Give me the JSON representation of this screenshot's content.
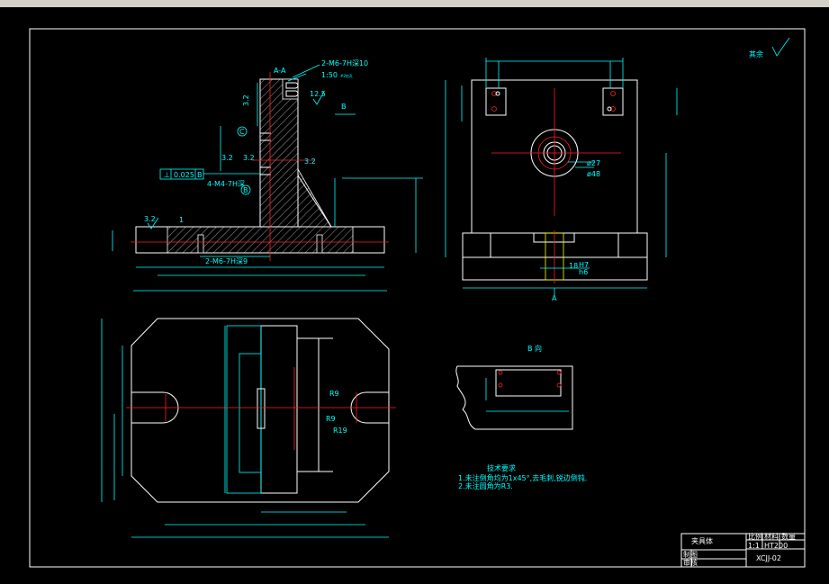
{
  "labels": {
    "section_aa": "A-A",
    "thread_top": "2-M6-7H深10",
    "taper": "1:50",
    "taper_note": "#2钻孔",
    "rough_125": "12.5",
    "view_b_arrow": "B",
    "rough_32_left": "3.2",
    "rough_32_a": "3.2",
    "rough_32_b": "3.2",
    "rough_32_c": "3.2",
    "rough_32_base": "3.2",
    "datum_c": "C",
    "datum_b": "B",
    "datum_b_circle": "B",
    "tol_symbol": "⊥",
    "tol_value": "0.025",
    "thread_m4": "4-M4-7H深",
    "thread_m6_bottom": "2-M6-7H深9",
    "dia_27": "ø27",
    "dia_48": "ø48",
    "fit_18": "18",
    "fit_h7": "H7",
    "fit_h6": "h6",
    "arrow_a": "A",
    "r9_top": "R9",
    "r9_bottom": "R9",
    "r19": "R19",
    "view_b_title": "B 向",
    "tech_title": "技术要求",
    "tech_line1": "1.未注倒角均为1x45°,去毛刺,锐边倒钝.",
    "tech_line2": "2.未注圆角为R3.",
    "roughness_rest": "其余",
    "other": "1"
  },
  "title_block": {
    "name": "夹具体",
    "scale": "1:1",
    "material": "HT200",
    "drawing_no": "XCJJ-02",
    "col_a": "比例",
    "col_b": "材料",
    "col_c": "数量",
    "drawn": "制图",
    "checked": "审核"
  },
  "colors": {
    "outline": "#ffffff",
    "dimension": "#00ffff",
    "center": "#ff2020",
    "hatch": "#ffffff",
    "hidden": "#ffff00"
  }
}
